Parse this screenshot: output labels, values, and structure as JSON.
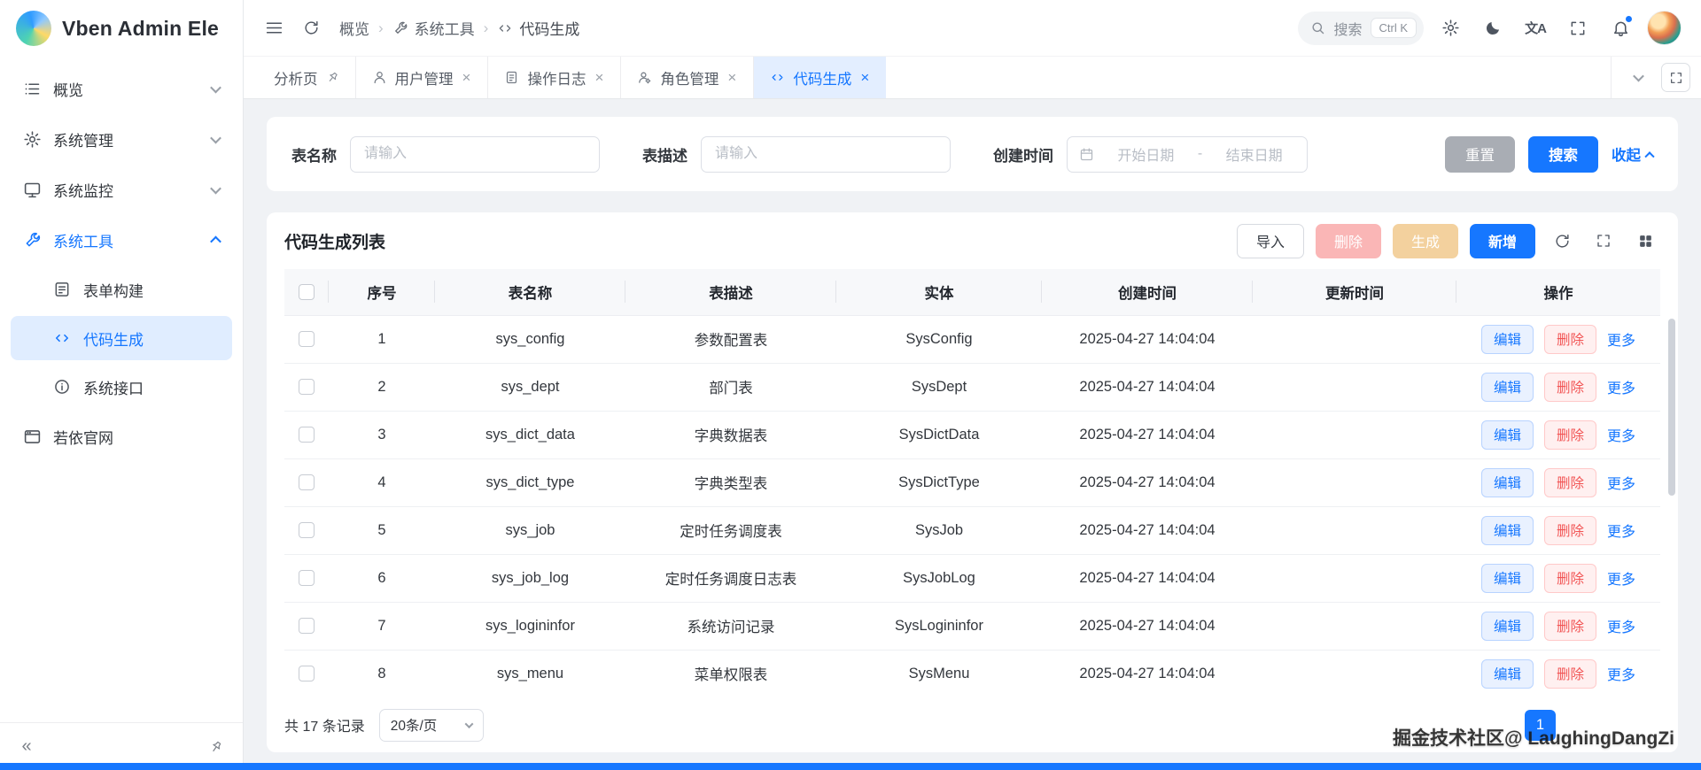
{
  "theme": {
    "primary": "#1677ff",
    "primary-light": "#e6f0ff",
    "danger": "#f56c6c",
    "danger-light": "#fff0f0",
    "danger-disabled": "#fab6b6",
    "warning-disabled": "#f3d19e",
    "page-bg": "#f0f2f5"
  },
  "app": {
    "title": "Vben Admin Ele"
  },
  "header": {
    "breadcrumb": [
      {
        "label": "概览"
      },
      {
        "label": "系统工具",
        "icon": "tool-icon"
      },
      {
        "label": "代码生成",
        "icon": "code-icon"
      }
    ],
    "search_placeholder": "搜索",
    "search_shortcut": "Ctrl K",
    "icons": [
      "search-icon",
      "gear-icon",
      "moon-icon",
      "translate-icon",
      "fullscreen-icon",
      "bell-icon",
      "avatar"
    ]
  },
  "sidebar": {
    "items": [
      {
        "label": "概览",
        "icon": "dashboard-icon"
      },
      {
        "label": "系统管理",
        "icon": "settings-icon"
      },
      {
        "label": "系统监控",
        "icon": "monitor-icon"
      },
      {
        "label": "系统工具",
        "icon": "tool-icon",
        "expanded": true,
        "children": [
          {
            "label": "表单构建",
            "icon": "form-icon"
          },
          {
            "label": "代码生成",
            "icon": "code-icon",
            "active": true
          },
          {
            "label": "系统接口",
            "icon": "api-icon"
          }
        ]
      },
      {
        "label": "若依官网",
        "icon": "website-icon"
      }
    ]
  },
  "tabs": [
    {
      "label": "分析页",
      "pinned": true
    },
    {
      "label": "用户管理",
      "icon": "user-icon",
      "closable": true
    },
    {
      "label": "操作日志",
      "icon": "log-icon",
      "closable": true
    },
    {
      "label": "角色管理",
      "icon": "role-icon",
      "closable": true
    },
    {
      "label": "代码生成",
      "icon": "code-icon",
      "closable": true,
      "active": true
    }
  ],
  "filter": {
    "name_label": "表名称",
    "desc_label": "表描述",
    "time_label": "创建时间",
    "input_placeholder": "请输入",
    "date_start": "开始日期",
    "date_separator": "-",
    "date_end": "结束日期",
    "reset_label": "重置",
    "search_label": "搜索",
    "collapse_label": "收起"
  },
  "list": {
    "title": "代码生成列表",
    "toolbar": {
      "import": "导入",
      "delete": "删除",
      "generate": "生成",
      "add": "新增"
    },
    "columns": [
      "序号",
      "表名称",
      "表描述",
      "实体",
      "创建时间",
      "更新时间",
      "操作"
    ],
    "row_actions": {
      "edit": "编辑",
      "delete": "删除",
      "more": "更多"
    },
    "rows": [
      {
        "no": "1",
        "table": "sys_config",
        "desc": "参数配置表",
        "entity": "SysConfig",
        "created": "2025-04-27 14:04:04",
        "updated": ""
      },
      {
        "no": "2",
        "table": "sys_dept",
        "desc": "部门表",
        "entity": "SysDept",
        "created": "2025-04-27 14:04:04",
        "updated": ""
      },
      {
        "no": "3",
        "table": "sys_dict_data",
        "desc": "字典数据表",
        "entity": "SysDictData",
        "created": "2025-04-27 14:04:04",
        "updated": ""
      },
      {
        "no": "4",
        "table": "sys_dict_type",
        "desc": "字典类型表",
        "entity": "SysDictType",
        "created": "2025-04-27 14:04:04",
        "updated": ""
      },
      {
        "no": "5",
        "table": "sys_job",
        "desc": "定时任务调度表",
        "entity": "SysJob",
        "created": "2025-04-27 14:04:04",
        "updated": ""
      },
      {
        "no": "6",
        "table": "sys_job_log",
        "desc": "定时任务调度日志表",
        "entity": "SysJobLog",
        "created": "2025-04-27 14:04:04",
        "updated": ""
      },
      {
        "no": "7",
        "table": "sys_logininfor",
        "desc": "系统访问记录",
        "entity": "SysLogininfor",
        "created": "2025-04-27 14:04:04",
        "updated": ""
      },
      {
        "no": "8",
        "table": "sys_menu",
        "desc": "菜单权限表",
        "entity": "SysMenu",
        "created": "2025-04-27 14:04:04",
        "updated": ""
      }
    ],
    "footer": {
      "total_text": "共 17 条记录",
      "page_size": "20条/页",
      "current_page": "1"
    }
  },
  "watermark": {
    "text": "掘金技术社区@ LaughingDangZi"
  }
}
